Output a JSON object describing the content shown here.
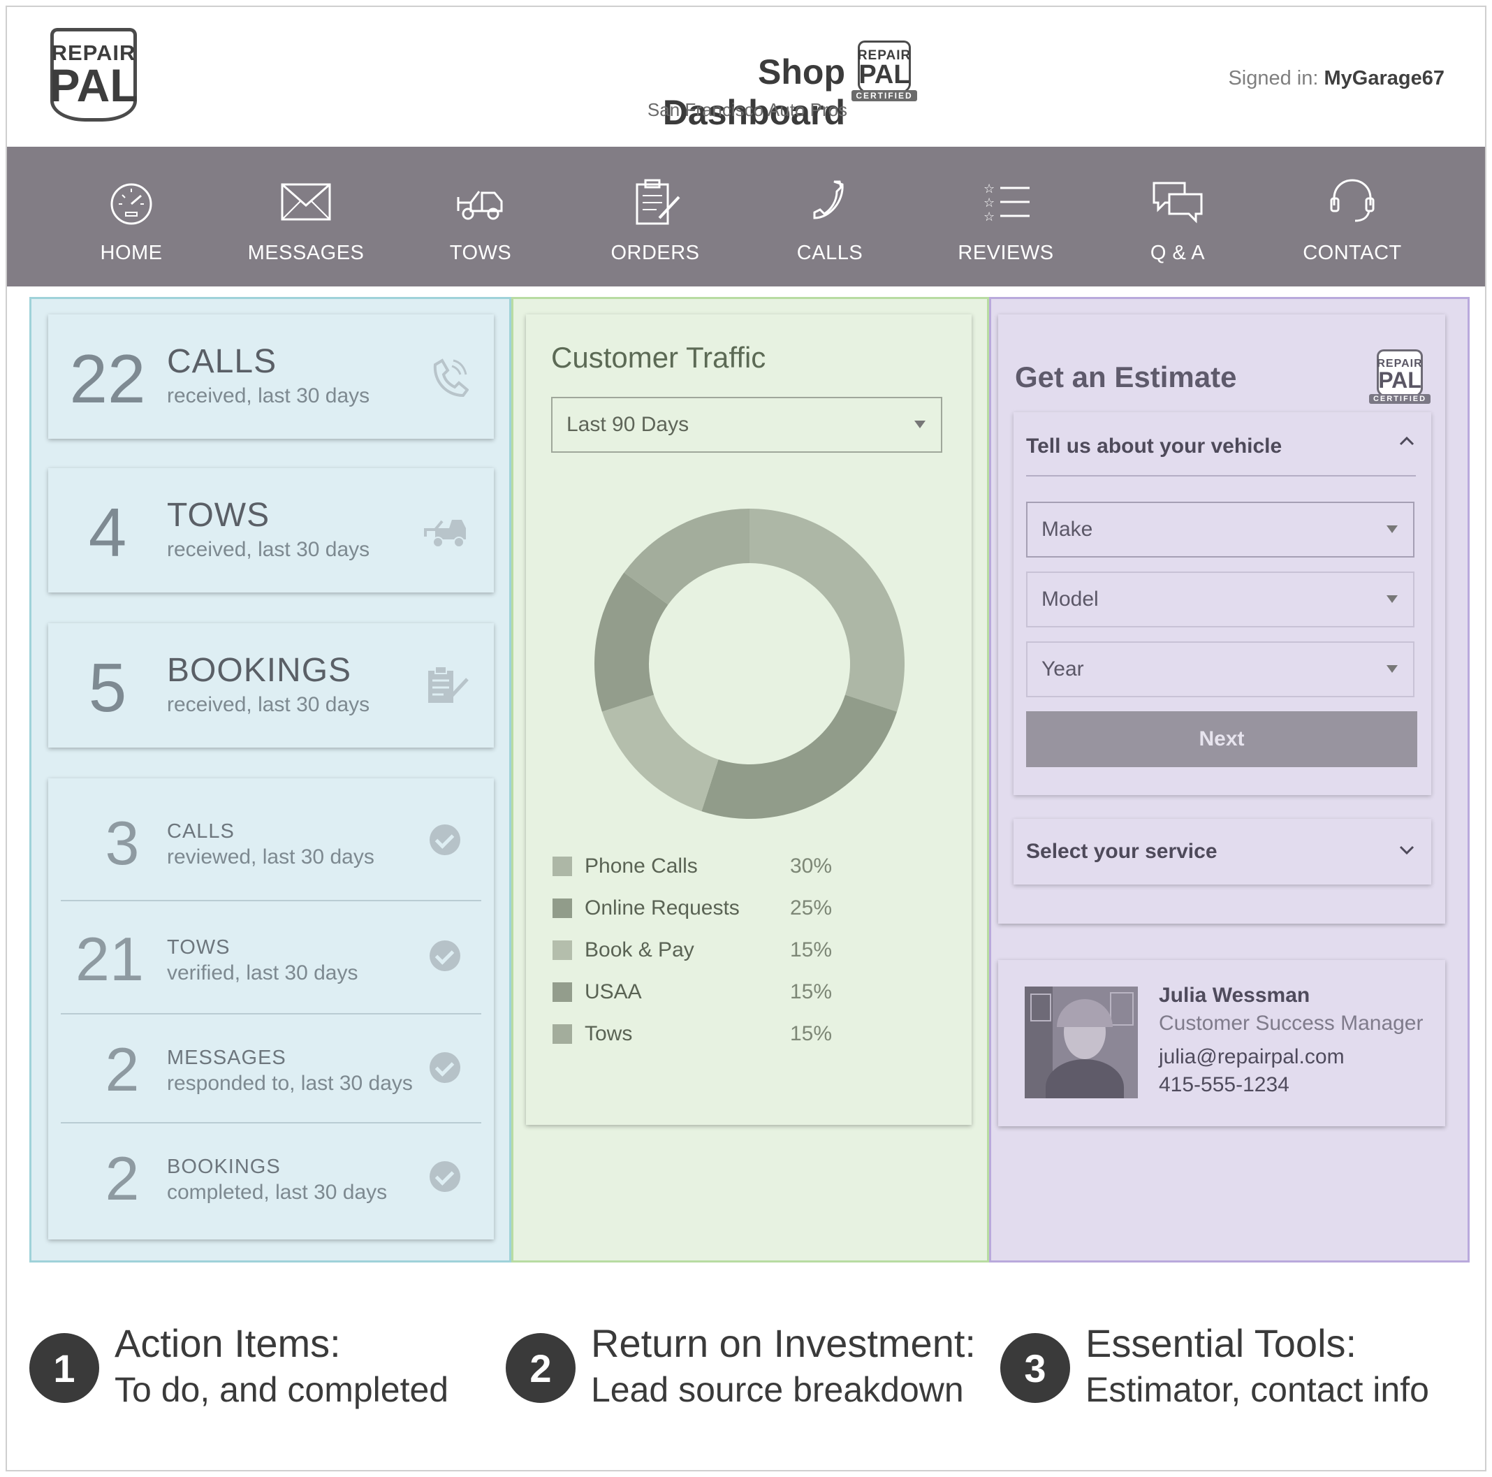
{
  "header": {
    "logo_line1": "REPAIR",
    "logo_line2": "PAL",
    "title": "Shop Dashboard",
    "subtitle": "San Francisco Auto Pros",
    "badge_line1": "REPAIR",
    "badge_line2": "PAL",
    "badge_line3": "CERTIFIED",
    "signed_label": "Signed in:",
    "signed_user": "MyGarage67"
  },
  "nav": {
    "items": [
      {
        "label": "HOME",
        "icon": "speedometer-icon"
      },
      {
        "label": "MESSAGES",
        "icon": "envelope-icon"
      },
      {
        "label": "TOWS",
        "icon": "tow-truck-icon"
      },
      {
        "label": "ORDERS",
        "icon": "clipboard-icon"
      },
      {
        "label": "CALLS",
        "icon": "phone-icon"
      },
      {
        "label": "REVIEWS",
        "icon": "star-list-icon"
      },
      {
        "label": "Q & A",
        "icon": "chat-bubbles-icon"
      },
      {
        "label": "CONTACT",
        "icon": "headset-icon"
      }
    ]
  },
  "action_items": {
    "todo": [
      {
        "count": "22",
        "title": "CALLS",
        "subtitle": "received, last 30 days",
        "icon": "phone-icon"
      },
      {
        "count": "4",
        "title": "TOWS",
        "subtitle": "received, last 30 days",
        "icon": "tow-truck-icon"
      },
      {
        "count": "5",
        "title": "BOOKINGS",
        "subtitle": "received, last 30 days",
        "icon": "clipboard-icon"
      }
    ],
    "completed": [
      {
        "count": "3",
        "title": "CALLS",
        "subtitle": "reviewed, last 30 days"
      },
      {
        "count": "21",
        "title": "TOWS",
        "subtitle": "verified, last 30 days"
      },
      {
        "count": "2",
        "title": "MESSAGES",
        "subtitle": "responded to, last 30 days"
      },
      {
        "count": "2",
        "title": "BOOKINGS",
        "subtitle": "completed, last 30 days"
      }
    ]
  },
  "traffic": {
    "title": "Customer Traffic",
    "range": "Last 90 Days"
  },
  "chart_data": {
    "type": "pie",
    "title": "Customer Traffic",
    "categories": [
      "Phone Calls",
      "Online Requests",
      "Book & Pay",
      "USAA",
      "Tows"
    ],
    "values": [
      30,
      25,
      15,
      15,
      15
    ],
    "labels": [
      "30%",
      "25%",
      "15%",
      "15%",
      "15%"
    ],
    "colors": [
      "#adb7a6",
      "#919c8a",
      "#b4beac",
      "#939d8c",
      "#a3ad9c"
    ],
    "donut": true,
    "legend": "bottom"
  },
  "estimate": {
    "title": "Get an Estimate",
    "vehicle_header": "Tell us about your vehicle",
    "make": "Make",
    "model": "Model",
    "year": "Year",
    "next": "Next",
    "service_header": "Select your service"
  },
  "contact": {
    "name": "Julia Wessman",
    "role": "Customer Success Manager",
    "email": "julia@repairpal.com",
    "phone": "415-555-1234"
  },
  "footer": [
    {
      "num": "1",
      "title": "Action Items:",
      "sub": "To do, and completed"
    },
    {
      "num": "2",
      "title": "Return on Investment:",
      "sub": "Lead source breakdown"
    },
    {
      "num": "3",
      "title": "Essential Tools:",
      "sub": "Estimator, contact info"
    }
  ],
  "colors": {
    "nav_bg": "#827d85",
    "panel1_bg": "#deeef3",
    "panel2_bg": "#e7f2e1",
    "panel3_bg": "#e2dcee"
  }
}
